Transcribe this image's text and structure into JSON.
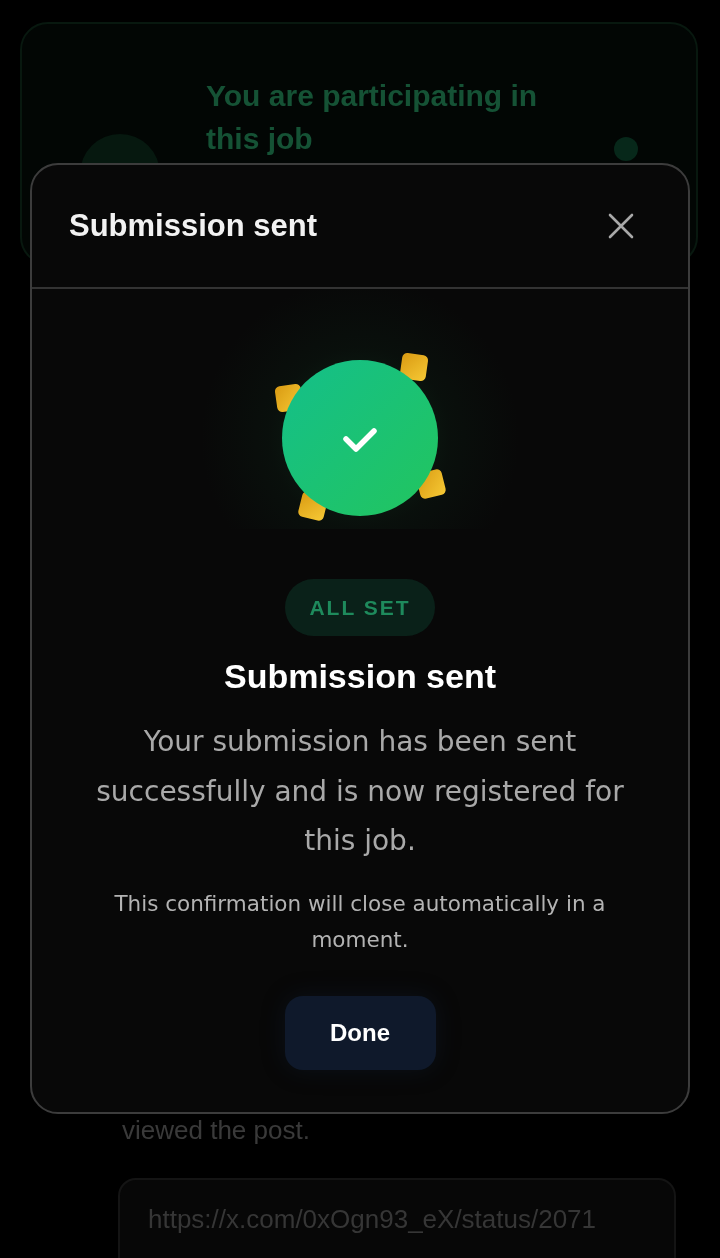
{
  "background_page": {
    "participation_card": {
      "message": "You are participating in this job"
    },
    "post_note": "viewed the post.",
    "post_link_field": {
      "value": "https://x.com/0xOgn93_eX/status/2071"
    }
  },
  "dialog": {
    "title": "Submission sent",
    "badge": "ALL SET",
    "heading": "Submission sent",
    "message": "Your submission has been sent successfully and is now registered for this job.",
    "note": "This confirmation will close automatically in a moment.",
    "buttons": [
      {
        "label": "Done"
      }
    ]
  }
}
